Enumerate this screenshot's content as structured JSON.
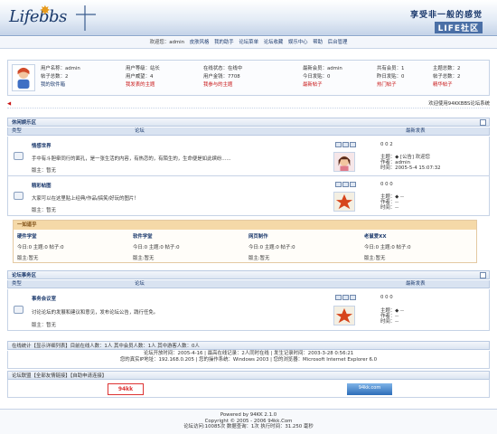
{
  "header": {
    "logo_text": "Lifebbs",
    "slogan": "享受非一般的感觉",
    "site_name": "LIFE社区"
  },
  "topnav": {
    "items": [
      "欢迎您：admin",
      "皮肤风格",
      "我的助手",
      "论坛菜单",
      "论坛收藏",
      "娱乐中心",
      "帮助",
      "后台管理"
    ]
  },
  "userinfo": {
    "username": "用户名称：admin",
    "level": "用户等级：站长",
    "status": "在线状态：在线中",
    "posts": "帖子总数：2",
    "prestige": "用户威望：4",
    "money": "用户金钱：7708",
    "software": "我的软件箱",
    "my_topics": "我发表的主题",
    "my_replies": "我参与的主题",
    "newest_member": "最新会员：admin",
    "today_posts": "今日发贴：0",
    "newest_posts": "最新帖子",
    "total_members": "共有会员：1",
    "yesterday_posts": "昨日发贴：0",
    "hot_posts": "热门帖子",
    "topic_total": "主题总数：2",
    "post_total": "帖子总数：2",
    "elite_posts": "精华帖子"
  },
  "marquee": "欢迎使用94KKBBS论坛系统",
  "section1": {
    "title": "休闲娱乐区",
    "col_type": "类型",
    "col_forum": "论坛",
    "col_last": "最新发表",
    "forums": [
      {
        "name": "情感世界",
        "desc": "手中有斗胆牵同行的面孔，是一张生活的内容，有热恋的，有陌生的，生命便是如此缤纷......",
        "mod": "版主：暂无",
        "stat": "0 0 2",
        "last_topic": "主题：◆ [公告] 欢迎您",
        "last_author": "作者：admin",
        "last_time": "时间：2005-5-4 15:07:32"
      },
      {
        "name": "精彩帖图",
        "desc": "大家可以在这里贴上经典/作品/搞笑/好玩的图片！",
        "mod": "版主：暂无",
        "stat": "0 0 0",
        "last_topic": "主题：◆ --",
        "last_author": "作者：--",
        "last_time": "时间：--"
      }
    ],
    "sub": {
      "title": "一如道乎",
      "cols": [
        {
          "name": "硬件学堂",
          "today": "今日:0 主题:0 帖子:0",
          "mod": "版主:暂无"
        },
        {
          "name": "软件学堂",
          "today": "今日:0 主题:0 帖子:0",
          "mod": "版主:暂无"
        },
        {
          "name": "网页制作",
          "today": "今日:0 主题:0 帖子:0",
          "mod": "版主:暂无"
        },
        {
          "name": "老鼠爱XX",
          "today": "今日:0 主题:0 帖子:0",
          "mod": "版主:暂无"
        }
      ]
    }
  },
  "section2": {
    "title": "论坛事务区",
    "col_type": "类型",
    "col_forum": "论坛",
    "col_last": "最新发表",
    "forum": {
      "name": "事务会议室",
      "desc": "讨论论坛的发展和建议和意见，发布论坛公告，践行任免。",
      "mod": "版主：暂无",
      "stat": "0 0 0",
      "last_topic": "主题：◆ --",
      "last_author": "作者：--",
      "last_time": "时间：--"
    }
  },
  "online": {
    "bar": "在线统计【显示详细列表】目前在线人数：1人 其中会员人数：1人 其中游客人数：0人",
    "line1": "论坛开放时间：2005-4-16 | 最高在线记录：2人同时在线 | 发生记录时间：2003-3-28 0:56:21",
    "line2": "您的真实IP地址：192.168.0.205 | 您的操作系统：Windows 2003 | 您的浏览器：Microsoft Internet Explorer 6.0"
  },
  "links": {
    "bar": "论坛联盟【全部友情链接】【自助申请连接】",
    "banner1": "94kk",
    "banner2": "94kk.com"
  },
  "footer": {
    "line1": "Powered by 94KK 2.1.0",
    "line2": "Copyright © 2005 - 2006 94kk.Com",
    "line3": "论坛访问:10085次 数据查询：1次 执行时间：31.250 毫秒"
  },
  "colors": {
    "accent": "#1d3b6e",
    "highlight": "#c81414",
    "header_bg": "#dde6f2"
  }
}
